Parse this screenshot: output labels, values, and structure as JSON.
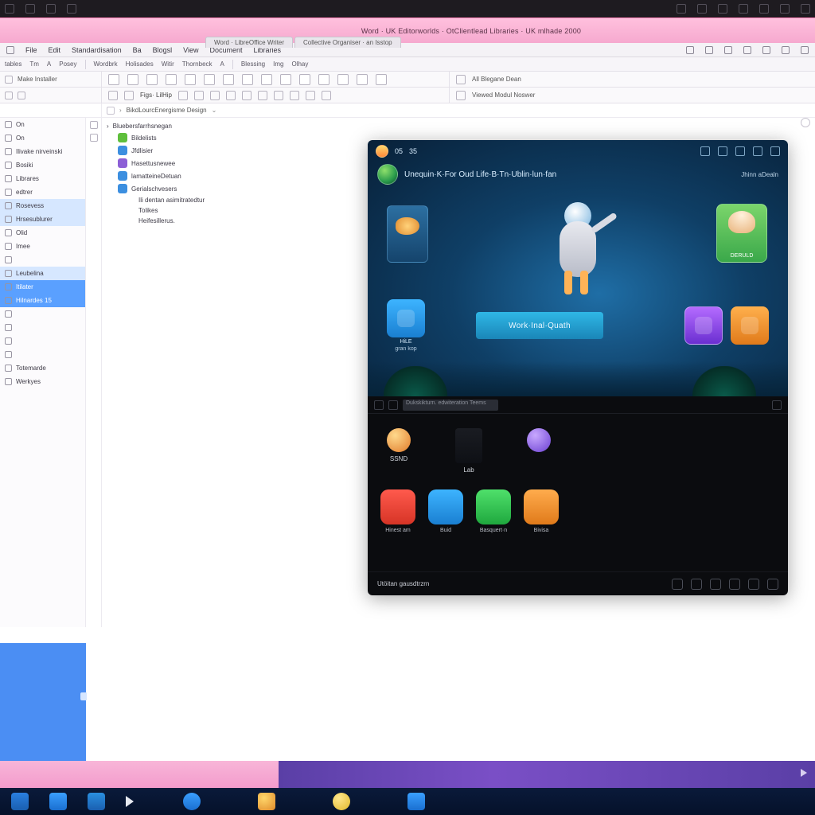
{
  "osbar": {
    "count_left": 4,
    "count_right": 7
  },
  "pinkbar": {
    "message": "Word · UK Editorworlds · OtClientlead Libraries · UK mlhade 2000",
    "tabs": [
      "Word · LibreOffice Writer",
      "Collective Organiser · an Isstop"
    ]
  },
  "menubar": {
    "items": [
      "File",
      "Edit",
      "Standardisation",
      "Ba",
      "Blogsl",
      "View",
      "Document",
      "Libraries"
    ],
    "right_icons": 7
  },
  "tool1": {
    "labels": [
      "tables",
      "Tm",
      "A",
      "Posey"
    ],
    "groups": [
      [
        "Wordbrk",
        "Holisades",
        "Witir",
        "Thornbeck",
        "A"
      ],
      [
        "Blessing",
        "Img",
        "Olhay"
      ]
    ],
    "btn_count": 6
  },
  "tool2": {
    "left_label": "Make Installer",
    "icon_count": 20,
    "right_label": "All Blegane Dean",
    "right_label2": "Viewed Modul Noswer"
  },
  "tool3": {
    "left_label": "",
    "mid_label": "Figs· LilHip"
  },
  "crumb": {
    "path": "BikdLourcEnergisme Design"
  },
  "sidebar": {
    "items": [
      {
        "label": "On"
      },
      {
        "label": "On"
      },
      {
        "label": "Ilivake nirveinski"
      },
      {
        "label": "Bosiki"
      },
      {
        "label": "Librares"
      },
      {
        "label": "edtrer"
      },
      {
        "label": "Rosevess",
        "sel": "sel"
      },
      {
        "label": "Hrsesublurer",
        "sel": "sel"
      },
      {
        "label": "Olid"
      },
      {
        "label": "Imee"
      },
      {
        "label": ""
      },
      {
        "label": "Leubelina",
        "sel": "sel"
      },
      {
        "label": "Itilater",
        "sel": "sel2"
      },
      {
        "label": "Hilnardes 15",
        "sel": "sel2"
      },
      {
        "label": ""
      },
      {
        "label": ""
      },
      {
        "label": ""
      },
      {
        "label": ""
      },
      {
        "label": "Totemarde"
      },
      {
        "label": "Werkyes"
      }
    ]
  },
  "tree": {
    "root": "Bluebersfarrhsnegan",
    "items": [
      {
        "icon": "green",
        "label": "Bildelists"
      },
      {
        "icon": "blue",
        "label": "Jfdlisier"
      },
      {
        "icon": "purple",
        "label": "Hasettusnewee"
      },
      {
        "icon": "blue",
        "label": "lamatteineDetuan"
      },
      {
        "icon": "",
        "label": "Gerialschvesers"
      }
    ],
    "sub": [
      {
        "label": "Ili dentan asimitratedtur"
      },
      {
        "label": "Tolikes"
      },
      {
        "label": "Heifesillerus."
      }
    ]
  },
  "overlay": {
    "top": {
      "id": "05",
      "tab": "35"
    },
    "title": "Unequin·K·For Oud Life·B·Tn·Ublin·lun·fan",
    "sub": "Jhinn aDealn",
    "card_r_label": "DERULD",
    "cta": "Work·Inal·Quath",
    "tiles": {
      "left_label": "HiLE",
      "left_sub": "gran kop"
    },
    "search_placeholder": "Dukskikturn. edwiteration Teems",
    "friends": [
      {
        "name": "SSND"
      },
      {
        "name": ""
      }
    ],
    "ladder_label": "Lab",
    "apps": [
      {
        "cls": "a-red",
        "label": "Hinest am"
      },
      {
        "cls": "a-blue",
        "label": "Buid"
      },
      {
        "cls": "a-green",
        "label": "Basquert·n"
      },
      {
        "cls": "a-oran",
        "label": "Bivisa"
      }
    ],
    "footer": "Utöitan gausdtrzrn"
  }
}
